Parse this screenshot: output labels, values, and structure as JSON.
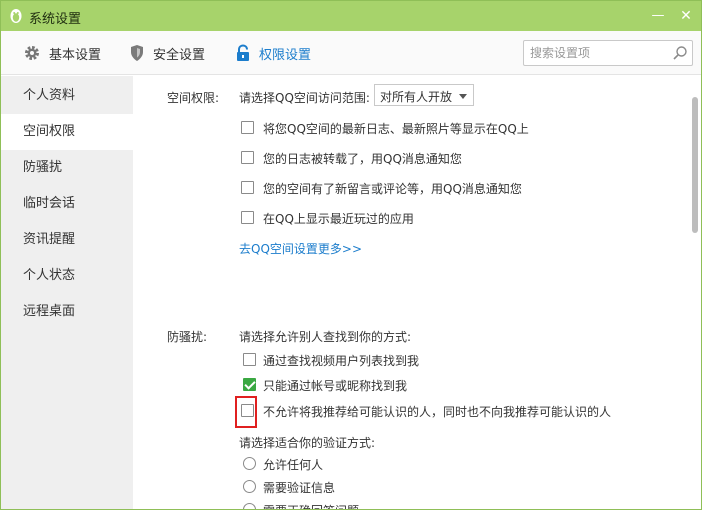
{
  "window": {
    "title": "系统设置",
    "minimize_glyph": "—",
    "close_glyph": "✕"
  },
  "toolbar": {
    "tabs": [
      {
        "label": "基本设置",
        "icon": "gear-icon"
      },
      {
        "label": "安全设置",
        "icon": "shield-icon"
      },
      {
        "label": "权限设置",
        "icon": "lock-icon"
      }
    ],
    "search_placeholder": "搜索设置项"
  },
  "sidebar": {
    "items": [
      {
        "label": "个人资料"
      },
      {
        "label": "空间权限"
      },
      {
        "label": "防骚扰"
      },
      {
        "label": "临时会话"
      },
      {
        "label": "资讯提醒"
      },
      {
        "label": "个人状态"
      },
      {
        "label": "远程桌面"
      }
    ],
    "active_index": 1
  },
  "space": {
    "label": "空间权限:",
    "range_label": "请选择QQ空间访问范围:",
    "range_value": "对所有人开放",
    "options": [
      {
        "label": "将您QQ空间的最新日志、最新照片等显示在QQ上",
        "checked": false
      },
      {
        "label": "您的日志被转载了，用QQ消息通知您",
        "checked": false
      },
      {
        "label": "您的空间有了新留言或评论等，用QQ消息通知您",
        "checked": false
      },
      {
        "label": "在QQ上显示最近玩过的应用",
        "checked": false
      }
    ],
    "more_link": "去QQ空间设置更多>>"
  },
  "harass": {
    "label": "防骚扰:",
    "find_label": "请选择允许别人查找到你的方式:",
    "options": [
      {
        "label": "通过查找视频用户列表找到我",
        "checked": false
      },
      {
        "label": "只能通过帐号或昵称找到我",
        "checked": true
      },
      {
        "label": "不允许将我推荐给可能认识的人，同时也不向我推荐可能认识的人",
        "checked": false
      }
    ],
    "verify_label": "请选择适合你的验证方式:",
    "verify_options": [
      {
        "label": "允许任何人"
      },
      {
        "label": "需要验证信息"
      },
      {
        "label": "需要正确回答问题"
      }
    ]
  }
}
